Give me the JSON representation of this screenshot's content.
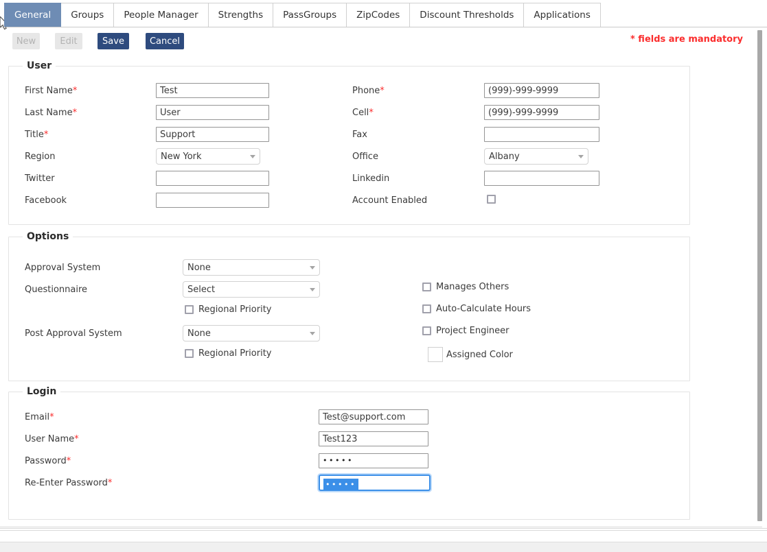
{
  "tabs": [
    {
      "label": "General",
      "active": true
    },
    {
      "label": "Groups",
      "active": false
    },
    {
      "label": "People Manager",
      "active": false
    },
    {
      "label": "Strengths",
      "active": false
    },
    {
      "label": "PassGroups",
      "active": false
    },
    {
      "label": "ZipCodes",
      "active": false
    },
    {
      "label": "Discount Thresholds",
      "active": false
    },
    {
      "label": "Applications",
      "active": false
    }
  ],
  "toolbar": {
    "new_label": "New",
    "edit_label": "Edit",
    "save_label": "Save",
    "cancel_label": "Cancel",
    "mandatory_note": "* fields are mandatory"
  },
  "colors": {
    "active_tab_bg": "#6e8cb4",
    "primary_button_bg": "#2e4b7e",
    "required_red": "#fb2d2d",
    "focus_blue": "#3b8fe8",
    "selection_blue": "#3b8fe8"
  },
  "user_section": {
    "legend": "User",
    "left": [
      {
        "label": "First Name",
        "required": true,
        "type": "text",
        "value": "Test"
      },
      {
        "label": "Last Name",
        "required": true,
        "type": "text",
        "value": "User"
      },
      {
        "label": "Title",
        "required": true,
        "type": "text",
        "value": "Support"
      },
      {
        "label": "Region",
        "required": false,
        "type": "select",
        "value": "New York"
      },
      {
        "label": "Twitter",
        "required": false,
        "type": "text",
        "value": ""
      },
      {
        "label": "Facebook",
        "required": false,
        "type": "text",
        "value": ""
      }
    ],
    "right": [
      {
        "label": "Phone",
        "required": true,
        "type": "text",
        "value": "(999)-999-9999"
      },
      {
        "label": "Cell",
        "required": true,
        "type": "text",
        "value": "(999)-999-9999"
      },
      {
        "label": "Fax",
        "required": false,
        "type": "text",
        "value": ""
      },
      {
        "label": "Office",
        "required": false,
        "type": "select",
        "value": "Albany"
      },
      {
        "label": "Linkedin",
        "required": false,
        "type": "text",
        "value": ""
      },
      {
        "label": "Account Enabled",
        "required": false,
        "type": "checkbox",
        "checked": false
      }
    ]
  },
  "options_section": {
    "legend": "Options",
    "rows": [
      {
        "label": "Approval System",
        "value": "None"
      },
      {
        "label": "Questionnaire",
        "value": "Select"
      },
      {
        "label": "Post Approval System",
        "value": "None"
      }
    ],
    "regional_priority_1": "Regional Priority",
    "regional_priority_2": "Regional Priority",
    "right_checkboxes": [
      {
        "label": "Manages Others",
        "checked": false
      },
      {
        "label": "Auto-Calculate Hours",
        "checked": false
      },
      {
        "label": "Project Engineer",
        "checked": false
      }
    ],
    "assigned_color_label": "Assigned Color",
    "assigned_color_value": "#ffffff"
  },
  "login_section": {
    "legend": "Login",
    "fields": [
      {
        "label": "Email",
        "required": true,
        "value": "Test@support.com",
        "masked": false,
        "focused": false
      },
      {
        "label": "User Name",
        "required": true,
        "value": "Test123",
        "masked": false,
        "focused": false
      },
      {
        "label": "Password",
        "required": true,
        "value": "•••••",
        "masked": true,
        "focused": false
      },
      {
        "label": "Re-Enter Password",
        "required": true,
        "value": "•••••",
        "masked": true,
        "focused": true
      }
    ]
  }
}
